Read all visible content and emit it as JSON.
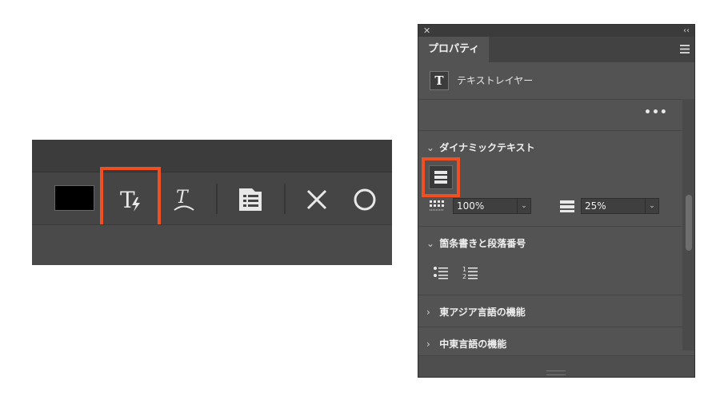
{
  "options_bar": {
    "color_swatch": "#000000",
    "icons": [
      "text-dynamic-icon",
      "text-warp-icon",
      "character-panel-icon",
      "cancel-icon",
      "commit-icon"
    ],
    "highlight_color": "#f04e23"
  },
  "panel": {
    "close_glyph": "✕",
    "collapse_glyph": "‹‹",
    "tab_label": "プロパティ",
    "layer_icon_glyph": "T",
    "layer_name": "テキストレイヤー",
    "more_dots": "•••",
    "sections": {
      "dynamic_text": {
        "chevron": "⌄",
        "title": "ダイナミックテキスト"
      },
      "bullets": {
        "chevron": "⌄",
        "title": "箇条書きと段落番号"
      },
      "east_asian": {
        "chevron": "›",
        "title": "東アジア言語の機能"
      },
      "middle_east": {
        "chevron": "›",
        "title": "中東言語の機能"
      }
    },
    "fields": {
      "width_value": "100%",
      "spacing_value": "25%",
      "caret_glyph": "⌄"
    }
  }
}
